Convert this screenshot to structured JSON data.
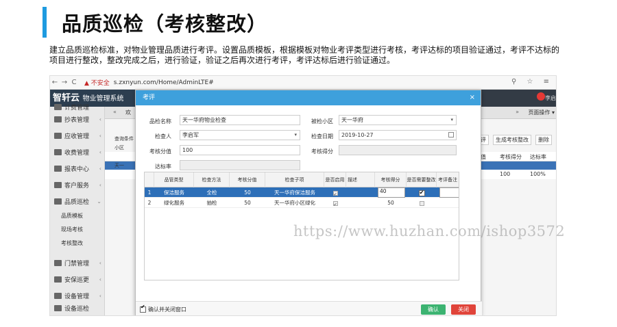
{
  "slide": {
    "title": "品质巡检（考核整改）",
    "description": "建立品质巡检标准，对物业管理品质进行考评。设置品质模板，根据模板对物业考评类型进行考核，考评达标的项目验证通过，考评不达标的项目进行整改，整改完成之后，进行验证，验证之后再次进行考评，考评达标后进行验证通过。"
  },
  "browser": {
    "back": "←",
    "forward": "→",
    "reload": "C",
    "insecure": "▲ 不安全",
    "url": "s.zxnyun.com/Home/AdminLTE#",
    "right_icons": "⚲ ☆ ≡"
  },
  "app": {
    "logo": "智轩云",
    "logo_sub": "物业管理系统",
    "user": "李启"
  },
  "sidebar": {
    "top_cut": "计费管理",
    "items": [
      {
        "label": "抄表管理"
      },
      {
        "label": "应收管理"
      },
      {
        "label": "收费管理"
      },
      {
        "label": "报表中心"
      },
      {
        "label": "客户服务"
      },
      {
        "label": "品质巡检"
      }
    ],
    "sub_items": [
      "品质模板",
      "现场考核",
      "考核整改"
    ],
    "items_after": [
      {
        "label": "门禁管理"
      },
      {
        "label": "安保巡更"
      },
      {
        "label": "设备管理"
      },
      {
        "label": "设备巡检"
      }
    ]
  },
  "content": {
    "tab": "欢",
    "page_ops": "页面操作 ▾",
    "toolbar": [
      "评",
      "生成考核整改",
      "删除"
    ],
    "bg_headers": [
      "值",
      "考核得分",
      "达标率"
    ],
    "bg_row": [
      "100",
      "100%"
    ],
    "bg_left": [
      "查询条件",
      "小区",
      "天一",
      "天一"
    ]
  },
  "modal": {
    "title": "考评",
    "close": "×",
    "labels": {
      "check_name": "品检名称",
      "community": "被检小区",
      "inspector": "检查人",
      "check_date": "检查日期",
      "score_points": "考核分值",
      "score_got": "考核得分",
      "rate": "达标率"
    },
    "values": {
      "check_name": "天一华府物业检查",
      "community": "天一华府",
      "inspector": "李启军",
      "check_date": "2019-10-27",
      "score_points": "100",
      "score_got": "",
      "rate": ""
    },
    "grid_headers": [
      "品管类型",
      "检查方法",
      "考核分值",
      "检查子项",
      "是否启用",
      "描述",
      "考核得分",
      "是否需要整改",
      "考评备注"
    ],
    "grid_rows": [
      {
        "no": "1",
        "type": "保洁服务",
        "method": "全检",
        "points": "50",
        "item": "天一华府保洁服务",
        "enabled": true,
        "desc": "",
        "score": "40",
        "rectify": true,
        "remark": ""
      },
      {
        "no": "2",
        "type": "绿化服务",
        "method": "抽检",
        "points": "50",
        "item": "天一华府小区绿化",
        "enabled": true,
        "desc": "",
        "score": "50",
        "rectify": false,
        "remark": ""
      }
    ],
    "footer_check": "确认并关闭窗口",
    "ok": "确认",
    "cancel": "关闭"
  },
  "watermark": "https://www.huzhan.com/ishop3572"
}
